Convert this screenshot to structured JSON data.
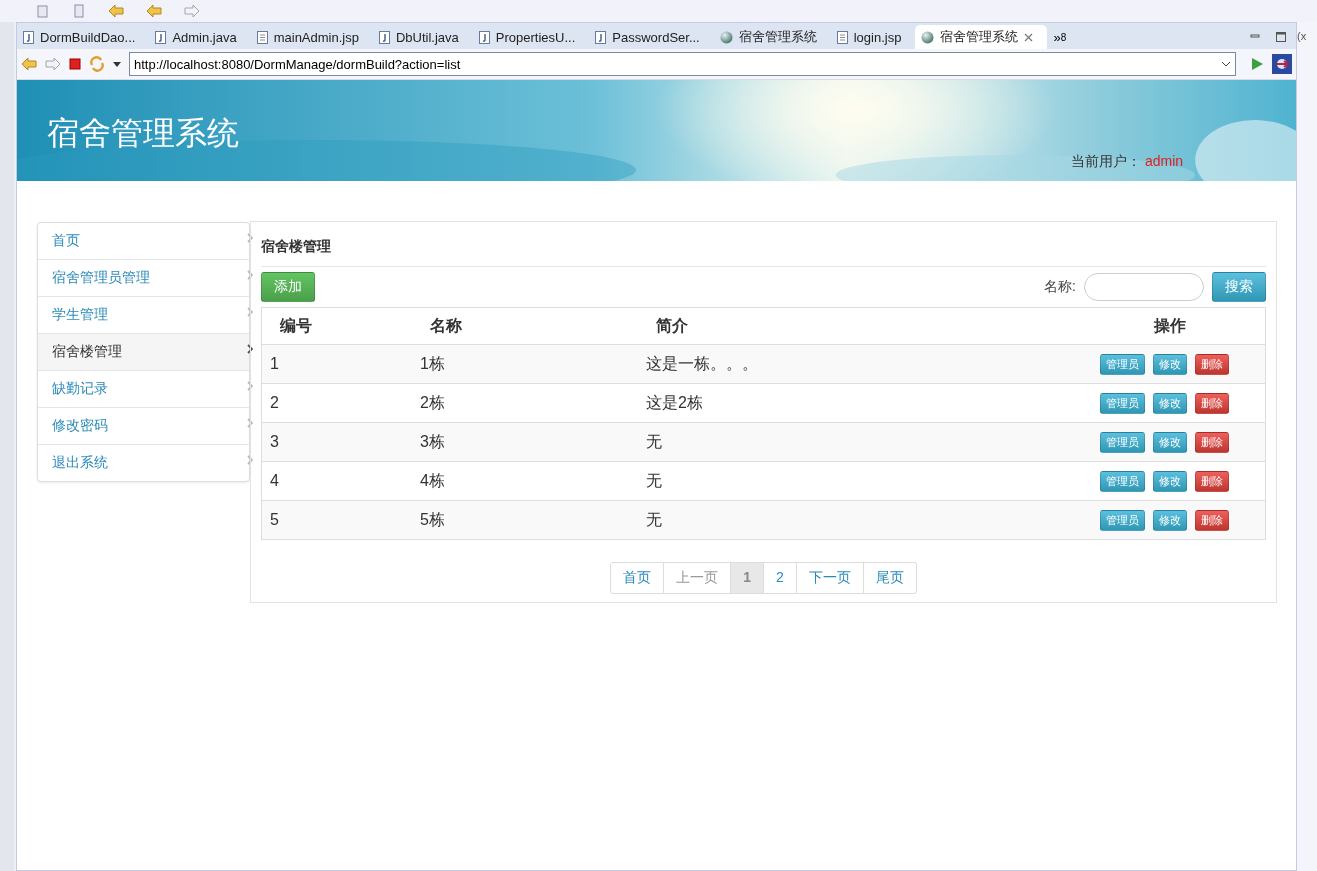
{
  "editor_tabs": [
    {
      "label": "DormBuildDao...",
      "kind": "java",
      "selected": false
    },
    {
      "label": "Admin.java",
      "kind": "java",
      "selected": false
    },
    {
      "label": "mainAdmin.jsp",
      "kind": "jsp",
      "selected": false
    },
    {
      "label": "DbUtil.java",
      "kind": "java",
      "selected": false
    },
    {
      "label": "PropertiesU...",
      "kind": "java",
      "selected": false
    },
    {
      "label": "PasswordSer...",
      "kind": "java",
      "selected": false
    },
    {
      "label": "宿舍管理系统",
      "kind": "browser",
      "selected": false
    },
    {
      "label": "login.jsp",
      "kind": "jsp",
      "selected": false
    },
    {
      "label": "宿舍管理系统",
      "kind": "browser",
      "selected": true
    }
  ],
  "overflow": {
    "symbol": "»",
    "count": "8"
  },
  "side_view_text": "(x",
  "browser": {
    "url": "http://localhost:8080/DormManage/dormBuild?action=list"
  },
  "header": {
    "title": "宿舍管理系统",
    "user_label": "当前用户：",
    "user": "admin"
  },
  "sidebar": {
    "items": [
      {
        "label": "首页",
        "selected": false
      },
      {
        "label": "宿舍管理员管理",
        "selected": false
      },
      {
        "label": "学生管理",
        "selected": false
      },
      {
        "label": "宿舍楼管理",
        "selected": true
      },
      {
        "label": "缺勤记录",
        "selected": false
      },
      {
        "label": "修改密码",
        "selected": false
      },
      {
        "label": "退出系统",
        "selected": false
      }
    ]
  },
  "panel": {
    "title": "宿舍楼管理",
    "add_button": "添加",
    "search_label": "名称:",
    "search_button": "搜索"
  },
  "table": {
    "columns": [
      "编号",
      "名称",
      "简介",
      "操作"
    ],
    "rows": [
      {
        "cells": [
          "1",
          "1栋",
          "这是一栋。。。"
        ],
        "actions": [
          {
            "label": "管理员",
            "kind": "info"
          },
          {
            "label": "修改",
            "kind": "info"
          },
          {
            "label": "删除",
            "kind": "danger"
          }
        ]
      },
      {
        "cells": [
          "2",
          "2栋",
          "这是2栋"
        ],
        "actions": [
          {
            "label": "管理员",
            "kind": "info"
          },
          {
            "label": "修改",
            "kind": "info"
          },
          {
            "label": "删除",
            "kind": "danger"
          }
        ]
      },
      {
        "cells": [
          "3",
          "3栋",
          "无"
        ],
        "actions": [
          {
            "label": "管理员",
            "kind": "info"
          },
          {
            "label": "修改",
            "kind": "info"
          },
          {
            "label": "删除",
            "kind": "danger"
          }
        ]
      },
      {
        "cells": [
          "4",
          "4栋",
          "无"
        ],
        "actions": [
          {
            "label": "管理员",
            "kind": "info"
          },
          {
            "label": "修改",
            "kind": "info"
          },
          {
            "label": "删除",
            "kind": "danger"
          }
        ]
      },
      {
        "cells": [
          "5",
          "5栋",
          "无"
        ],
        "actions": [
          {
            "label": "管理员",
            "kind": "info"
          },
          {
            "label": "修改",
            "kind": "info"
          },
          {
            "label": "删除",
            "kind": "danger"
          }
        ]
      }
    ]
  },
  "pagination": [
    {
      "label": "首页",
      "selected": false,
      "disabled": false
    },
    {
      "label": "上一页",
      "selected": false,
      "disabled": true
    },
    {
      "label": "1",
      "selected": true,
      "disabled": false
    },
    {
      "label": "2",
      "selected": false,
      "disabled": false
    },
    {
      "label": "下一页",
      "selected": false,
      "disabled": false
    },
    {
      "label": "尾页",
      "selected": false,
      "disabled": false
    }
  ]
}
